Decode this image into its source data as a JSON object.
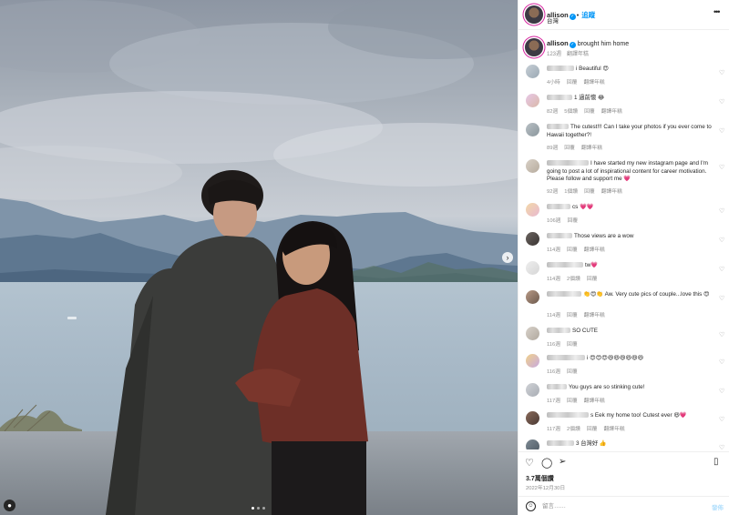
{
  "post": {
    "username": "allison",
    "follow_label": "追蹤",
    "location": "台灣",
    "more_label": "•••",
    "verified_mark": "✓"
  },
  "caption": {
    "username": "allison",
    "text": "brought him home",
    "time": "123週",
    "translate": "翻譯年糕"
  },
  "comments": [
    {
      "text": "i Beautiful 😍",
      "time": "4小時",
      "actions": [
        "回覆",
        "翻譯年糕"
      ]
    },
    {
      "text": "1 過前懷 😂",
      "time": "82週",
      "actions": [
        "5個讚",
        "回覆",
        "翻譯年糕"
      ]
    },
    {
      "text": "The cutest!!! Can I take your photos if you ever come to Hawaii together?!",
      "time": "89週",
      "actions": [
        "回覆",
        "翻譯年糕"
      ]
    },
    {
      "text": "I have started my new instagram page and I'm going to post a lot of inspirational content for career motivation. Please follow and support me 💗",
      "time": "92週",
      "actions": [
        "1個讚",
        "回覆",
        "翻譯年糕"
      ]
    },
    {
      "text": "cs 💗💗",
      "time": "106週",
      "actions": [
        "回覆"
      ]
    },
    {
      "text": "Those views are a wow",
      "time": "114週",
      "actions": [
        "回覆",
        "翻譯年糕"
      ]
    },
    {
      "text": "tw💗",
      "time": "114週",
      "actions": [
        "2個讚",
        "回覆"
      ]
    },
    {
      "text": "👏😍👏 Aw. Very cute pics of couple...love this 😍",
      "time": "114週",
      "actions": [
        "回覆",
        "翻譯年糕"
      ]
    },
    {
      "text": "SO CUTE",
      "time": "116週",
      "actions": [
        "回覆"
      ]
    },
    {
      "text": "i 😍😍😍😆😆😆😆😆😆",
      "time": "116週",
      "actions": [
        "回覆"
      ]
    },
    {
      "text": "You guys are so stinking cute!",
      "time": "117週",
      "actions": [
        "回覆",
        "翻譯年糕"
      ]
    },
    {
      "text": "s Eek my home too! Cutest ever 😆💗",
      "time": "117週",
      "actions": [
        "2個讚",
        "回覆",
        "翻譯年糕"
      ]
    },
    {
      "text": "3 台灣好 👍",
      "time": "",
      "actions": []
    }
  ],
  "stats": {
    "likes": "3.7萬個讚",
    "date": "2022年12月30日"
  },
  "comment_box": {
    "placeholder": "留言……",
    "post_label": "發佈"
  },
  "icons": {
    "like": "heart-icon",
    "comment": "comment-icon",
    "share": "share-icon",
    "save": "bookmark-icon",
    "emoji": "emoji-icon",
    "next": "chevron-right-icon",
    "tagged": "user-tag-icon"
  },
  "colors": {
    "link": "#0095f6",
    "muted": "#8e8e8e",
    "text": "#262626"
  }
}
